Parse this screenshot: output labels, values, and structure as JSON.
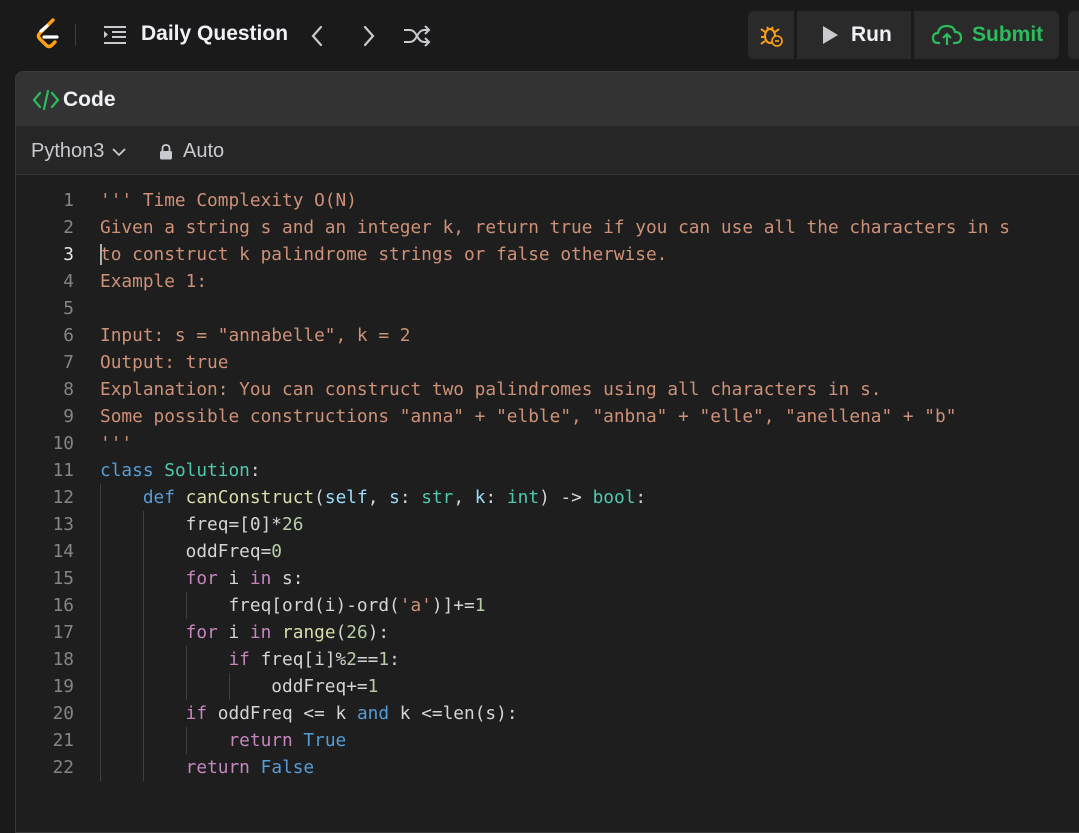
{
  "topbar": {
    "daily_question": "Daily Question",
    "run_label": "Run",
    "submit_label": "Submit",
    "icons": [
      "leetcode-logo",
      "list-icon",
      "chevron-left-icon",
      "chevron-right-icon",
      "shuffle-icon",
      "debug-icon",
      "play-icon",
      "cloud-upload-icon"
    ],
    "accent_color": "#2cbb5d"
  },
  "panel": {
    "title": "Code",
    "language": "Python3",
    "mode": "Auto"
  },
  "editor": {
    "active_line": 3,
    "lines": [
      {
        "num": "1",
        "tokens": [
          [
            "c-com",
            "''' Time Complexity O(N)"
          ]
        ]
      },
      {
        "num": "2",
        "tokens": [
          [
            "c-com",
            "Given a string s and an integer k, return true if you can use all the characters in s"
          ]
        ]
      },
      {
        "num": "3",
        "tokens": [
          [
            "c-com",
            "to construct k palindrome strings or false otherwise."
          ]
        ]
      },
      {
        "num": "4",
        "tokens": [
          [
            "c-com",
            "Example 1:"
          ]
        ]
      },
      {
        "num": "5",
        "tokens": []
      },
      {
        "num": "6",
        "tokens": [
          [
            "c-com",
            "Input: s = \"annabelle\", k = 2"
          ]
        ]
      },
      {
        "num": "7",
        "tokens": [
          [
            "c-com",
            "Output: true"
          ]
        ]
      },
      {
        "num": "8",
        "tokens": [
          [
            "c-com",
            "Explanation: You can construct two palindromes using all characters in s."
          ]
        ]
      },
      {
        "num": "9",
        "tokens": [
          [
            "c-com",
            "Some possible constructions \"anna\" + \"elble\", \"anbna\" + \"elle\", \"anellena\" + \"b\""
          ]
        ]
      },
      {
        "num": "10",
        "tokens": [
          [
            "c-com",
            "'''"
          ]
        ]
      },
      {
        "num": "11",
        "tokens": [
          [
            "c-kw",
            "class"
          ],
          [
            "c-txt",
            " "
          ],
          [
            "c-cls",
            "Solution"
          ],
          [
            "c-txt",
            ":"
          ]
        ]
      },
      {
        "num": "12",
        "tokens": [
          [
            "c-txt",
            "    "
          ],
          [
            "c-kw",
            "def"
          ],
          [
            "c-txt",
            " "
          ],
          [
            "c-fn",
            "canConstruct"
          ],
          [
            "c-txt",
            "("
          ],
          [
            "c-var",
            "self"
          ],
          [
            "c-txt",
            ", "
          ],
          [
            "c-var",
            "s"
          ],
          [
            "c-txt",
            ": "
          ],
          [
            "c-cls",
            "str"
          ],
          [
            "c-txt",
            ", "
          ],
          [
            "c-var",
            "k"
          ],
          [
            "c-txt",
            ": "
          ],
          [
            "c-cls",
            "int"
          ],
          [
            "c-txt",
            ") -> "
          ],
          [
            "c-cls",
            "bool"
          ],
          [
            "c-txt",
            ":"
          ]
        ]
      },
      {
        "num": "13",
        "tokens": [
          [
            "c-txt",
            "        freq=[0]*"
          ],
          [
            "c-num",
            "26"
          ]
        ]
      },
      {
        "num": "14",
        "tokens": [
          [
            "c-txt",
            "        oddFreq="
          ],
          [
            "c-num",
            "0"
          ]
        ]
      },
      {
        "num": "15",
        "tokens": [
          [
            "c-txt",
            "        "
          ],
          [
            "c-ctl",
            "for"
          ],
          [
            "c-txt",
            " i "
          ],
          [
            "c-ctl",
            "in"
          ],
          [
            "c-txt",
            " s:"
          ]
        ]
      },
      {
        "num": "16",
        "tokens": [
          [
            "c-txt",
            "            freq[ord(i)-ord("
          ],
          [
            "c-str",
            "'a'"
          ],
          [
            "c-txt",
            ")]+="
          ],
          [
            "c-num",
            "1"
          ]
        ]
      },
      {
        "num": "17",
        "tokens": [
          [
            "c-txt",
            "        "
          ],
          [
            "c-ctl",
            "for"
          ],
          [
            "c-txt",
            " i "
          ],
          [
            "c-ctl",
            "in"
          ],
          [
            "c-txt",
            " "
          ],
          [
            "c-fn",
            "range"
          ],
          [
            "c-txt",
            "("
          ],
          [
            "c-num",
            "26"
          ],
          [
            "c-txt",
            "):"
          ]
        ]
      },
      {
        "num": "18",
        "tokens": [
          [
            "c-txt",
            "            "
          ],
          [
            "c-ctl",
            "if"
          ],
          [
            "c-txt",
            " freq[i]%"
          ],
          [
            "c-num",
            "2"
          ],
          [
            "c-txt",
            "=="
          ],
          [
            "c-num",
            "1"
          ],
          [
            "c-txt",
            ":"
          ]
        ]
      },
      {
        "num": "19",
        "tokens": [
          [
            "c-txt",
            "                oddFreq+="
          ],
          [
            "c-num",
            "1"
          ]
        ]
      },
      {
        "num": "20",
        "tokens": [
          [
            "c-txt",
            "        "
          ],
          [
            "c-ctl",
            "if"
          ],
          [
            "c-txt",
            " oddFreq <= k "
          ],
          [
            "c-kw",
            "and"
          ],
          [
            "c-txt",
            " k <=len(s):"
          ]
        ]
      },
      {
        "num": "21",
        "tokens": [
          [
            "c-txt",
            "            "
          ],
          [
            "c-ctl",
            "return"
          ],
          [
            "c-txt",
            " "
          ],
          [
            "c-kw",
            "True"
          ]
        ]
      },
      {
        "num": "22",
        "tokens": [
          [
            "c-txt",
            "        "
          ],
          [
            "c-ctl",
            "return"
          ],
          [
            "c-txt",
            " "
          ],
          [
            "c-kw",
            "False"
          ]
        ]
      }
    ]
  }
}
